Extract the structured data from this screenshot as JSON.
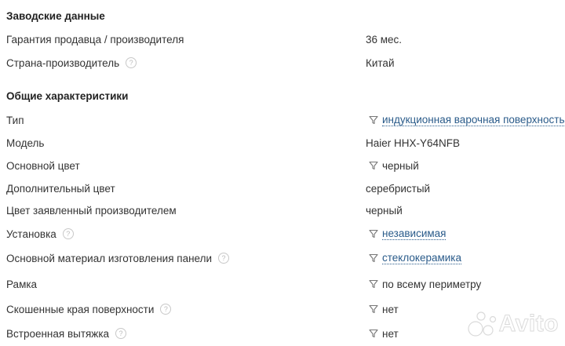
{
  "sections": [
    {
      "title": "Заводские данные"
    },
    {
      "title": "Общие характеристики"
    }
  ],
  "rows": [
    {
      "label": "Гарантия продавца / производителя",
      "value": "36 мес.",
      "help": false,
      "filter": false,
      "link": false
    },
    {
      "label": "Страна-производитель",
      "value": "Китай",
      "help": true,
      "filter": false,
      "link": false
    },
    {
      "label": "Тип",
      "value": "индукционная варочная поверхность",
      "help": false,
      "filter": true,
      "link": true
    },
    {
      "label": "Модель",
      "value": "Haier HHX-Y64NFB",
      "help": false,
      "filter": false,
      "link": false
    },
    {
      "label": "Основной цвет",
      "value": "черный",
      "help": false,
      "filter": true,
      "link": false
    },
    {
      "label": "Дополнительный цвет",
      "value": "серебристый",
      "help": false,
      "filter": false,
      "link": false
    },
    {
      "label": "Цвет заявленный производителем",
      "value": "черный",
      "help": false,
      "filter": false,
      "link": false
    },
    {
      "label": "Установка",
      "value": "независимая",
      "help": true,
      "filter": true,
      "link": true
    },
    {
      "label": "Основной материал изготовления панели",
      "value": "стеклокерамика",
      "help": true,
      "filter": true,
      "link": true
    },
    {
      "label": "Рамка",
      "value": "по всему периметру",
      "help": false,
      "filter": true,
      "link": false
    },
    {
      "label": "Скошенные края поверхности",
      "value": "нет",
      "help": true,
      "filter": true,
      "link": false
    },
    {
      "label": "Встроенная вытяжка",
      "value": "нет",
      "help": true,
      "filter": true,
      "link": false
    }
  ],
  "help_glyph": "?",
  "watermark": {
    "text": "Avito",
    "icon": "avito-dots-logo"
  },
  "colors": {
    "link": "#2a5b8a",
    "text": "#333333",
    "muted": "#c8c8c8"
  }
}
